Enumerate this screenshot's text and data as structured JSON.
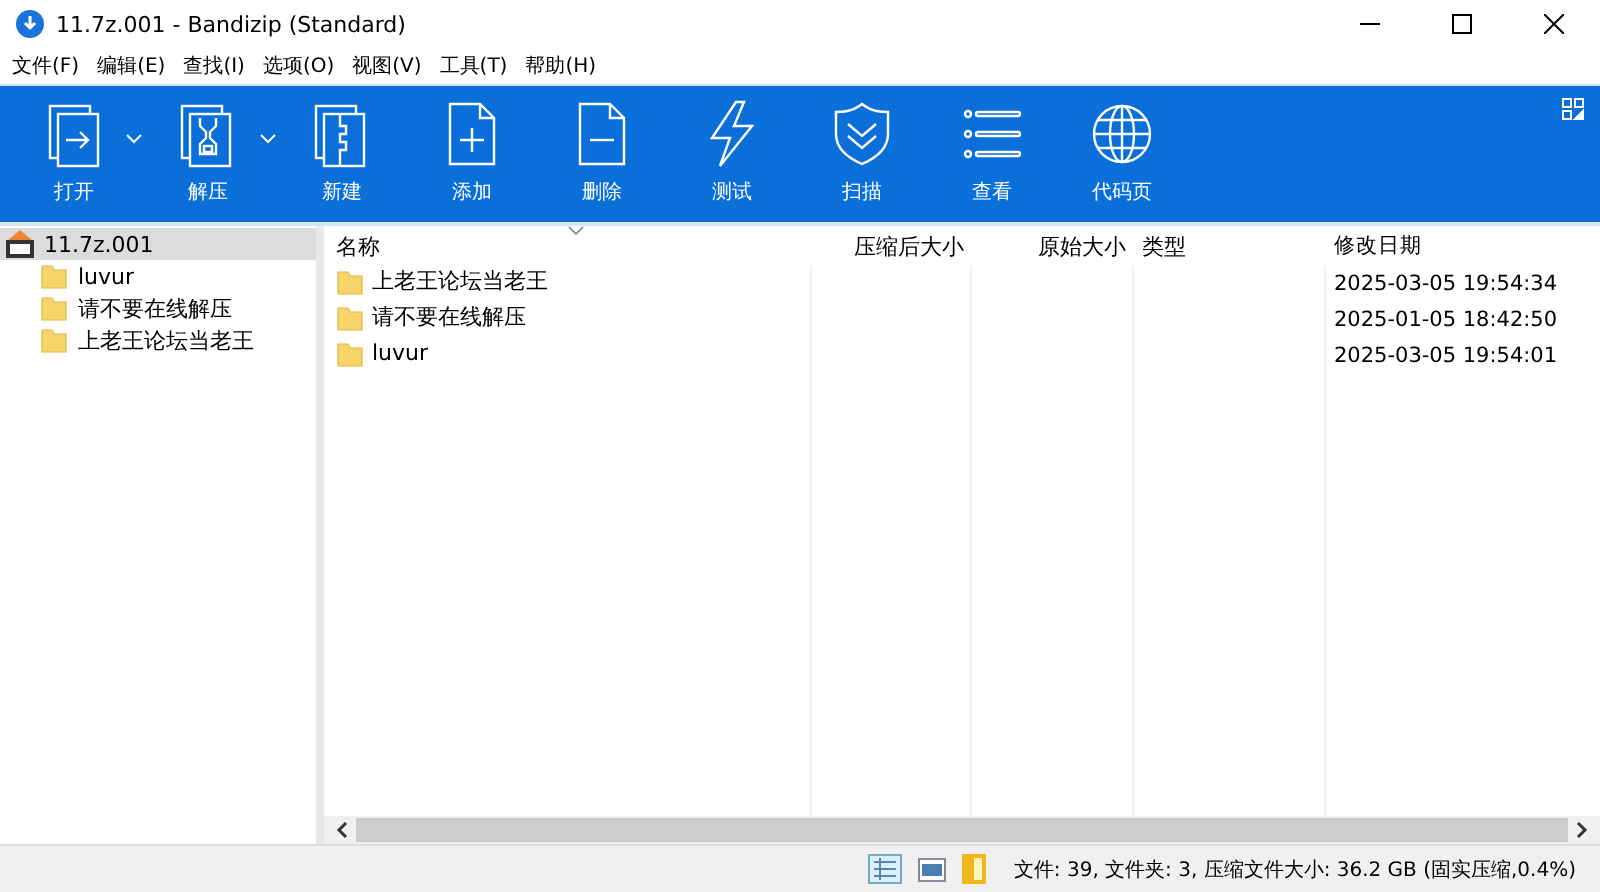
{
  "window": {
    "title": "11.7z.001 - Bandizip (Standard)"
  },
  "menu": [
    "文件(F)",
    "编辑(E)",
    "查找(I)",
    "选项(O)",
    "视图(V)",
    "工具(T)",
    "帮助(H)"
  ],
  "toolbar": [
    {
      "kind": "open",
      "label": "打开",
      "dropdown": true
    },
    {
      "kind": "extract",
      "label": "解压",
      "dropdown": true
    },
    {
      "kind": "new",
      "label": "新建",
      "dropdown": false
    },
    {
      "kind": "add",
      "label": "添加",
      "dropdown": false
    },
    {
      "kind": "delete",
      "label": "删除",
      "dropdown": false
    },
    {
      "kind": "test",
      "label": "测试",
      "dropdown": false
    },
    {
      "kind": "scan",
      "label": "扫描",
      "dropdown": false
    },
    {
      "kind": "view",
      "label": "查看",
      "dropdown": false
    },
    {
      "kind": "codepage",
      "label": "代码页",
      "dropdown": false
    }
  ],
  "tree": {
    "label": "11.7z.001",
    "selected": true,
    "children": [
      {
        "label": "luvur",
        "selected": false
      },
      {
        "label": "请不要在线解压",
        "selected": false
      },
      {
        "label": "上老王论坛当老王",
        "selected": false
      }
    ]
  },
  "table": {
    "columns": [
      "名称",
      "压缩后大小",
      "原始大小",
      "类型",
      "修改日期"
    ],
    "rows": [
      {
        "name": "上老王论坛当老王",
        "modified": "2025-03-05 19:54:34"
      },
      {
        "name": "请不要在线解压",
        "modified": "2025-01-05 18:42:50"
      },
      {
        "name": "luvur",
        "modified": "2025-03-05 19:54:01"
      }
    ]
  },
  "status_bar": {
    "text": "文件: 39, 文件夹: 3, 压缩文件大小: 36.2 GB (固实压缩,0.4%)"
  }
}
